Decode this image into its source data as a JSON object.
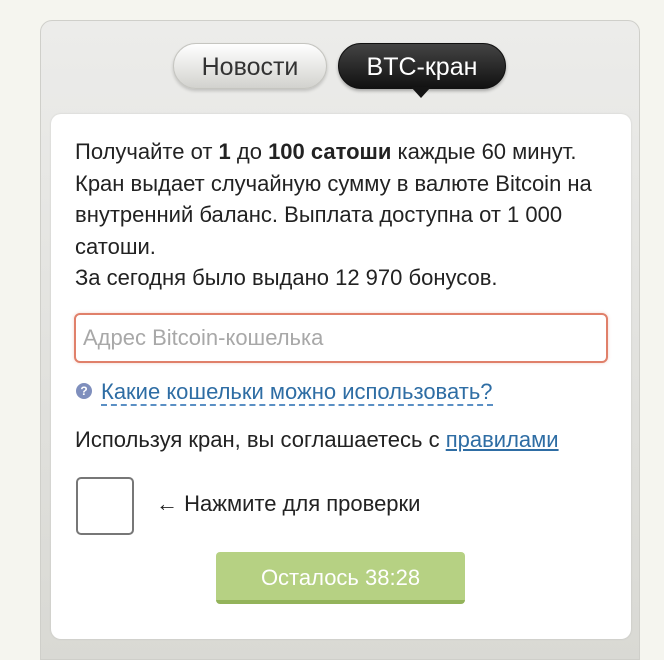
{
  "tabs": {
    "news": "Новости",
    "faucet": "BTC-кран"
  },
  "info": {
    "p1": "Получайте от ",
    "min": "1",
    "p2": " до ",
    "max": "100 сатоши",
    "p3": " каждые 60 минут. Кран выдает случайную сумму в валюте Bitcoin на внутренний баланс. Выплата доступна от 1 000 сатоши.",
    "issued": "За сегодня было выдано 12 970 бонусов."
  },
  "address_input": {
    "placeholder": "Адрес Bitcoin-кошелька",
    "value": ""
  },
  "help": {
    "icon": "?",
    "link": "Какие кошельки можно использовать?"
  },
  "terms": {
    "text": "Используя кран, вы соглашаетесь с ",
    "link": "правилами"
  },
  "captcha": {
    "hint": "← Нажмите для проверки"
  },
  "timer_button": {
    "label": "Осталось 38:28"
  },
  "colors": {
    "accent_input_border": "#e0806a",
    "link": "#2e6da4",
    "button": "#b6d183"
  }
}
